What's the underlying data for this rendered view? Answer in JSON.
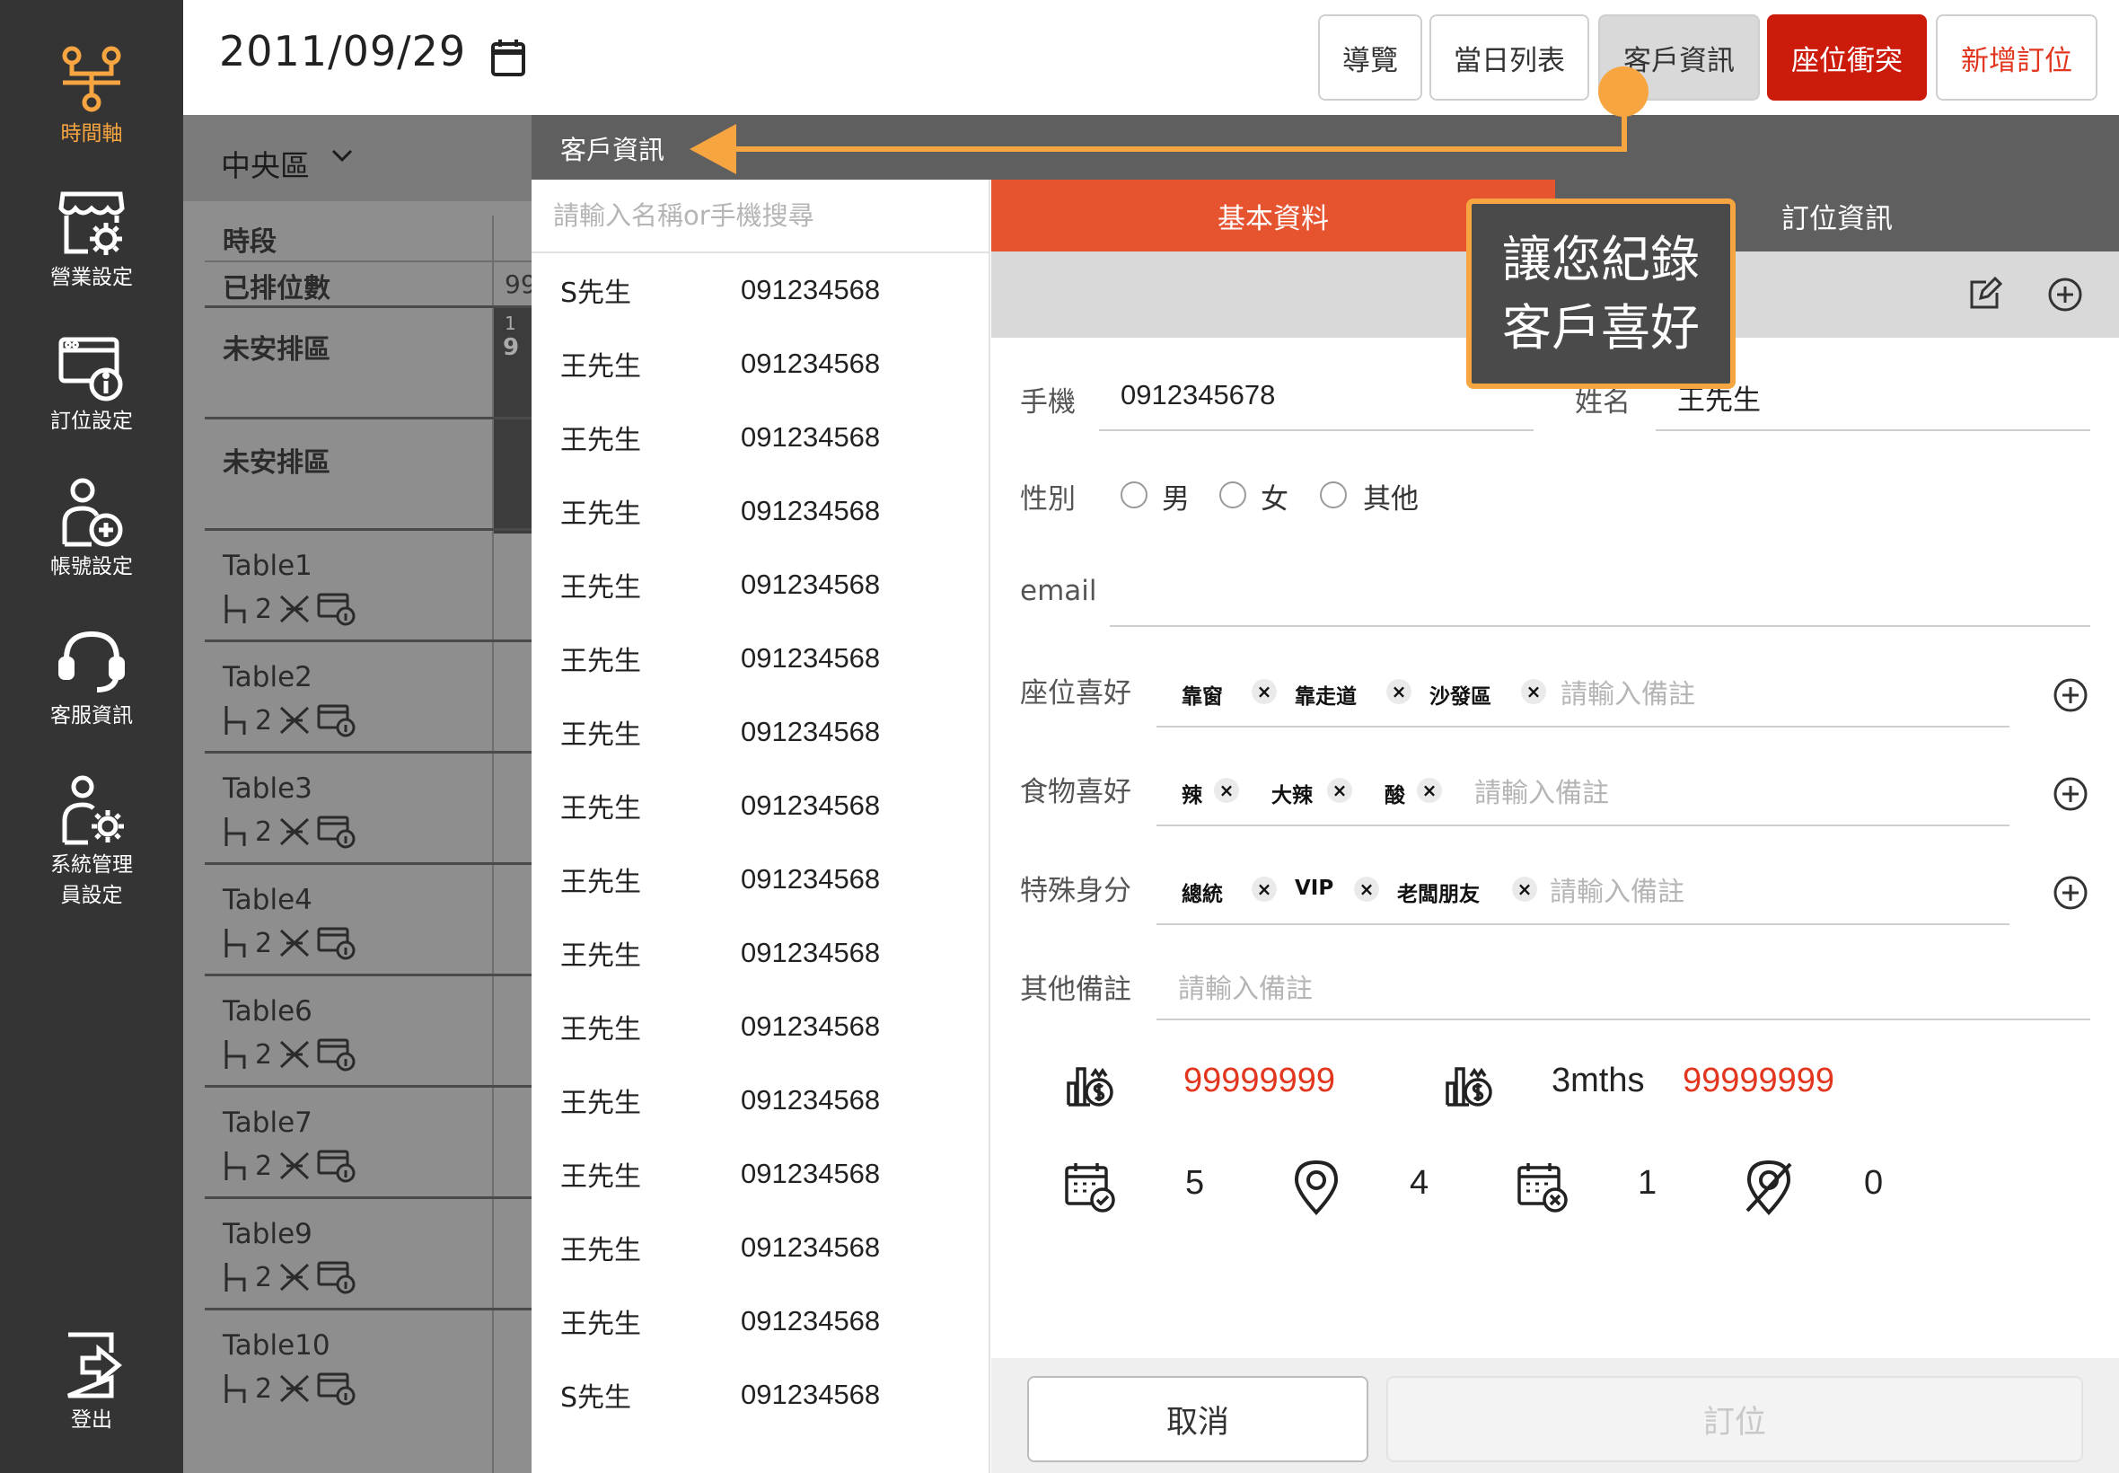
{
  "sidebar": {
    "items": [
      {
        "label": "時間軸",
        "icon": "timeline-icon"
      },
      {
        "label": "營業設定",
        "icon": "store-settings-icon"
      },
      {
        "label": "訂位設定",
        "icon": "booking-settings-icon"
      },
      {
        "label": "帳號設定",
        "icon": "account-add-icon"
      },
      {
        "label": "客服資訊",
        "icon": "headset-icon"
      },
      {
        "label": "系統管理",
        "label2": "員設定",
        "icon": "admin-settings-icon"
      },
      {
        "label": "登出",
        "icon": "logout-icon"
      }
    ],
    "active_color": "#f7a540"
  },
  "header": {
    "date": "2011/09/29",
    "buttons": {
      "guide": "導覽",
      "daily_list": "當日列表",
      "customer_info": "客戶資訊",
      "seat_conflict": "座位衝突",
      "new_booking": "新增訂位"
    }
  },
  "schedule": {
    "zone": "中央區",
    "time_slot": "時段",
    "arranged": "已排位數",
    "arranged_value": "99",
    "unarranged": "未安排區",
    "badge": "1",
    "badge2": "9",
    "tables": [
      {
        "name": "Table1",
        "seats": "2"
      },
      {
        "name": "Table2",
        "seats": "2"
      },
      {
        "name": "Table3",
        "seats": "2"
      },
      {
        "name": "Table4",
        "seats": "2"
      },
      {
        "name": "Table6",
        "seats": "2"
      },
      {
        "name": "Table7",
        "seats": "2"
      },
      {
        "name": "Table9",
        "seats": "2"
      },
      {
        "name": "Table10",
        "seats": "2"
      }
    ]
  },
  "overlay": {
    "title": "客戶資訊",
    "search_placeholder": "請輸入名稱or手機搜尋",
    "customers": [
      {
        "name": "S先生",
        "phone": "091234568"
      },
      {
        "name": "王先生",
        "phone": "091234568"
      },
      {
        "name": "王先生",
        "phone": "091234568"
      },
      {
        "name": "王先生",
        "phone": "091234568"
      },
      {
        "name": "王先生",
        "phone": "091234568"
      },
      {
        "name": "王先生",
        "phone": "091234568"
      },
      {
        "name": "王先生",
        "phone": "091234568"
      },
      {
        "name": "王先生",
        "phone": "091234568"
      },
      {
        "name": "王先生",
        "phone": "091234568"
      },
      {
        "name": "王先生",
        "phone": "091234568"
      },
      {
        "name": "王先生",
        "phone": "091234568"
      },
      {
        "name": "王先生",
        "phone": "091234568"
      },
      {
        "name": "王先生",
        "phone": "091234568"
      },
      {
        "name": "王先生",
        "phone": "091234568"
      },
      {
        "name": "王先生",
        "phone": "091234568"
      },
      {
        "name": "S先生",
        "phone": "091234568"
      }
    ]
  },
  "detail": {
    "tab_basic": "基本資料",
    "tab_booking": "訂位資訊",
    "phone_label": "手機",
    "phone_value": "0912345678",
    "name_label": "姓名",
    "name_value": "王先生",
    "gender_label": "性別",
    "gender_options": [
      "男",
      "女",
      "其他"
    ],
    "email_label": "email",
    "seat_pref_label": "座位喜好",
    "seat_pref_tags": [
      "靠窗",
      "靠走道",
      "沙發區"
    ],
    "food_pref_label": "食物喜好",
    "food_pref_tags": [
      "辣",
      "大辣",
      "酸"
    ],
    "identity_label": "特殊身分",
    "identity_tags": [
      "總統",
      "VIP",
      "老闆朋友"
    ],
    "other_label": "其他備註",
    "note_placeholder": "請輸入備註",
    "spend_total": "99999999",
    "spend_3m_label": "3mths",
    "spend_3m": "99999999",
    "completed": "5",
    "visited": "4",
    "cancelled": "1",
    "no_show": "0",
    "cancel_btn": "取消",
    "book_btn": "訂位"
  },
  "annotation": {
    "line1": "讓您紀錄",
    "line2": "客戶喜好",
    "color": "#f7a540"
  },
  "colors": {
    "accent": "#e5532f",
    "conflict": "#cc1b0b",
    "money": "#e2361f"
  }
}
